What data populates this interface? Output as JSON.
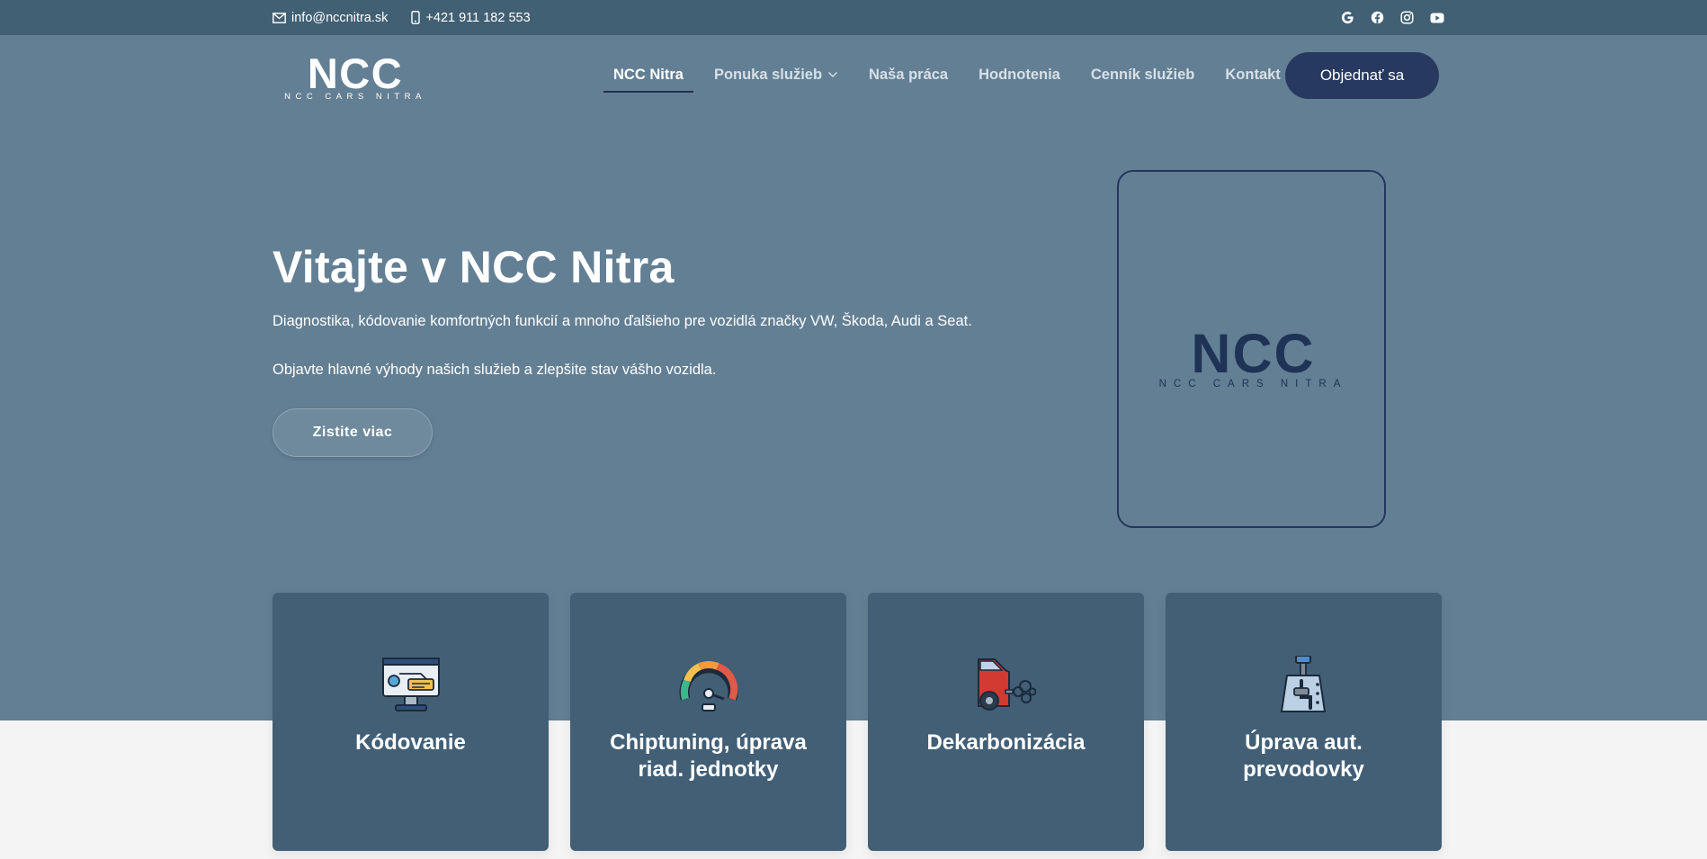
{
  "topbar": {
    "email": "info@nccnitra.sk",
    "phone": "+421 911 182 553",
    "social": [
      "google-icon",
      "facebook-icon",
      "instagram-icon",
      "youtube-icon"
    ]
  },
  "brand": {
    "logo_text": "NCC",
    "logo_subtext": "NCC CARS NITRA"
  },
  "nav": {
    "items": [
      {
        "label": "NCC Nitra",
        "active": true
      },
      {
        "label": "Ponuka služieb",
        "dropdown": true
      },
      {
        "label": "Naša práca"
      },
      {
        "label": "Hodnotenia"
      },
      {
        "label": "Cenník služieb"
      },
      {
        "label": "Kontakt"
      }
    ],
    "cta": "Objednať sa"
  },
  "hero": {
    "title": "Vitajte v NCC Nitra",
    "p1": "Diagnostika, kódovanie komfortných funkcií a mnoho ďalšieho pre vozidlá značky VW, Škoda, Audi a Seat.",
    "p2": "Objavte hlavné výhody našich služieb a zlepšite stav vášho vozidla.",
    "button": "Zistite viac"
  },
  "services": [
    {
      "title": "Kódovanie",
      "icon": "diagnostic-monitor-icon"
    },
    {
      "title": "Chiptuning, úprava riad. jednotky",
      "icon": "speedometer-icon"
    },
    {
      "title": "Dekarbonizácia",
      "icon": "car-exhaust-icon"
    },
    {
      "title": "Úprava aut. prevodovky",
      "icon": "gear-shifter-icon"
    }
  ],
  "colors": {
    "topbar": "#426074",
    "hero": "#637f94",
    "card": "#425f75",
    "accent": "#28395f",
    "logo_dark": "#1f3356"
  }
}
